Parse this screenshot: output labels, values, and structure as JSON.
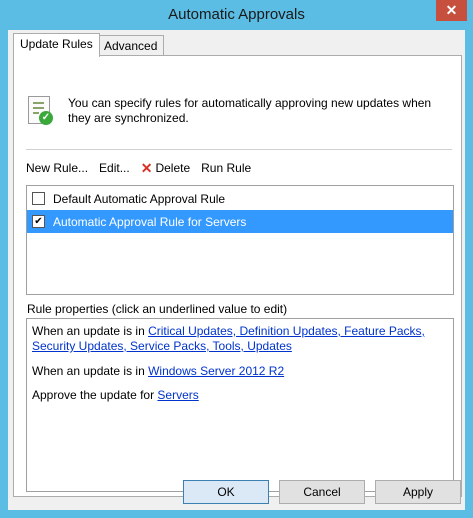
{
  "window": {
    "title": "Automatic Approvals",
    "close_glyph": "✕"
  },
  "tabs": [
    {
      "label": "Update Rules"
    },
    {
      "label": "Advanced"
    }
  ],
  "description": "You can specify rules for automatically approving new updates when they are synchronized.",
  "toolbar": {
    "new_rule": "New Rule...",
    "edit": "Edit...",
    "delete": "Delete",
    "run_rule": "Run Rule"
  },
  "rules": [
    {
      "label": "Default Automatic Approval Rule",
      "checked": false
    },
    {
      "label": "Automatic Approval Rule for Servers",
      "checked": true,
      "selected": true
    }
  ],
  "properties": {
    "header": "Rule properties (click an underlined value to edit)",
    "line1_prefix": "When an update is in ",
    "line1_link": "Critical Updates, Definition Updates, Feature Packs, Security Updates, Service Packs, Tools, Updates",
    "line2_prefix": "When an update is in ",
    "line2_link": "Windows Server 2012 R2",
    "line3_prefix": "Approve the update for ",
    "line3_link": "Servers"
  },
  "buttons": {
    "ok": "OK",
    "cancel": "Cancel",
    "apply": "Apply"
  },
  "colors": {
    "selection": "#3399ff",
    "link": "#0033cc",
    "frame": "#5bbde4",
    "close": "#c74f3e"
  }
}
